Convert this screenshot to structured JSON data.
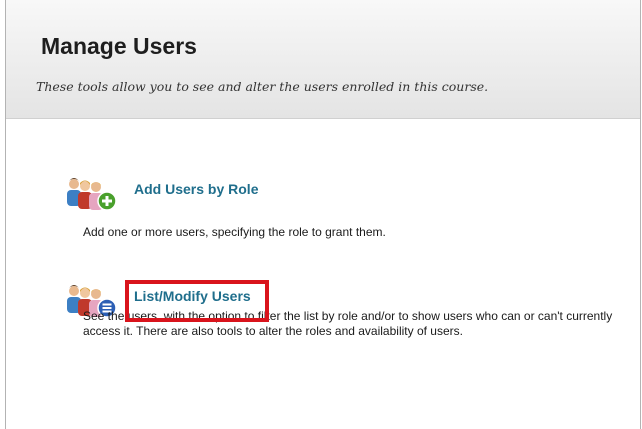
{
  "header": {
    "title": "Manage Users",
    "subtitle": "These tools allow you to see and alter the users enrolled in this course."
  },
  "tools": [
    {
      "label": "Add Users by Role",
      "description": "Add one or more users, specifying the role to grant them.",
      "icon": "users-add-icon"
    },
    {
      "label": "List/Modify Users",
      "description": "See the users, with the option to filter the list by role and/or to show users who can or can't currently access it. There are also tools to alter the roles and availability of users.",
      "icon": "users-list-icon",
      "highlighted": true
    }
  ],
  "colors": {
    "link": "#1f6e8c",
    "highlight": "#d9141c",
    "add_badge": "#4aa02c",
    "list_badge": "#2c5fb5"
  }
}
